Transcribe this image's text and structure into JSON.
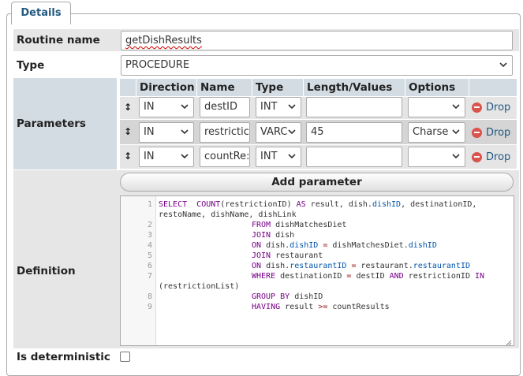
{
  "legend": "Details",
  "routine_name": {
    "label": "Routine name",
    "value": "getDishResults"
  },
  "type": {
    "label": "Type",
    "value": "PROCEDURE"
  },
  "parameters": {
    "label": "Parameters",
    "headers": [
      "Direction",
      "Name",
      "Type",
      "Length/Values",
      "Options"
    ],
    "drop_label": "Drop",
    "rows": [
      {
        "direction": "IN",
        "name": "destID",
        "type": "INT",
        "length": "",
        "options": ""
      },
      {
        "direction": "IN",
        "name": "restrictic",
        "type": "VARC",
        "length": "45",
        "options": "Charse"
      },
      {
        "direction": "IN",
        "name": "countRe:",
        "type": "INT",
        "length": "",
        "options": ""
      }
    ],
    "add_label": "Add parameter"
  },
  "definition": {
    "label": "Definition",
    "line_numbers": [
      "1",
      "2",
      "3",
      "4",
      "5",
      "6",
      "7",
      "8",
      "9"
    ]
  },
  "deterministic": {
    "label": "Is deterministic",
    "checked": false
  }
}
